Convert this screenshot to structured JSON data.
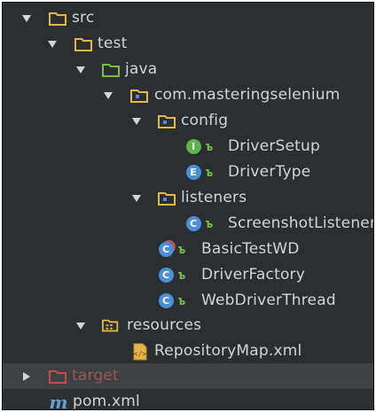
{
  "tree": {
    "src": "src",
    "test": "test",
    "java": "java",
    "package": "com.masteringselenium",
    "config": "config",
    "driver_setup": "DriverSetup",
    "driver_type": "DriverType",
    "listeners": "listeners",
    "screenshot_listener": "ScreenshotListener",
    "basic_test_wd": "BasicTestWD",
    "driver_factory": "DriverFactory",
    "web_driver_thread": "WebDriverThread",
    "resources": "resources",
    "repository_map": "RepositoryMap.xml",
    "target": "target",
    "pom": "pom.xml"
  },
  "badges": {
    "interface": "I",
    "enum": "E",
    "class": "C"
  },
  "colors": {
    "panel_bg": "#2b2f31",
    "folder": "#e3b648",
    "source_folder": "#74c241",
    "interface_badge": "#5bb44a",
    "class_badge": "#4a90d9",
    "excluded_folder": "#c9494b",
    "maven": "#6a9bd1"
  }
}
